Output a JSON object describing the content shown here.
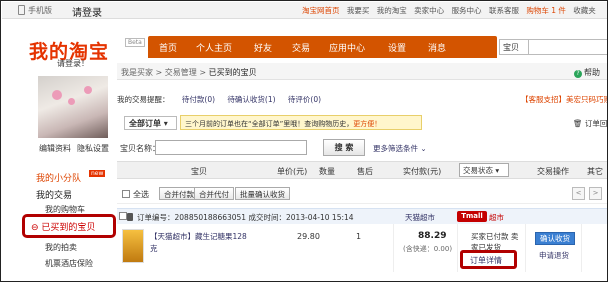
{
  "topbar": {
    "mobile": "手机版",
    "login": "请登录",
    "links": [
      "淘宝网首页",
      "我要买",
      "我的淘宝",
      "卖家中心",
      "服务中心",
      "联系客服",
      "购物车 1 件",
      "收藏夹"
    ]
  },
  "header": {
    "brand": "我的淘宝",
    "beta": "Beta",
    "please_login": "请登录！",
    "nav": [
      "首页",
      "个人主页",
      "好友",
      "交易",
      "应用中心",
      "设置",
      "消息"
    ],
    "search_select": "宝贝"
  },
  "sidebar": {
    "edit_profile": "编辑资料",
    "privacy": "隐私设置",
    "my_team": "我的小分队",
    "new_badge": "new",
    "my_trades": "我的交易",
    "items": [
      "我的购物车",
      "已买到的宝贝",
      "我的拍卖",
      "机票酒店保险"
    ]
  },
  "breadcrumb": {
    "items": [
      "我是买家",
      "交易管理",
      "已买到的宝贝"
    ],
    "separator": " > ",
    "help": "帮助"
  },
  "reminder": {
    "label": "我的交易提醒：",
    "links": [
      "待付款(0)",
      "待确认收货(1)",
      "待评价(0)"
    ],
    "support": "【客服支招】美宏只码巧购"
  },
  "filter": {
    "all_orders": "全部订单",
    "notice_prefix": "三个月前的订单也在“全部订单”里哦！查询购物历史，",
    "notice_link": "更方便！",
    "recycle": "订单回收站"
  },
  "search": {
    "label": "宝贝名称：",
    "button": "搜 索",
    "more": "更多筛选条件"
  },
  "table_header": {
    "item": "宝贝",
    "unit_price": "单价(元)",
    "quantity": "数量",
    "after_sales": "售后",
    "paid": "实付款(元)",
    "status": "交易状态",
    "operation": "交易操作",
    "other": "其它"
  },
  "batch": {
    "select_all": "全选",
    "merge_pay": "合并付款",
    "merge_agent": "合并代付",
    "batch_confirm": "批量确认收货",
    "prev": "<",
    "next": ">"
  },
  "order": {
    "header": "订单编号：208850188663051   成交时间：2013-04-10 15:14",
    "shop": "天猫超市",
    "tmall": "Tmall",
    "supermarket": "超市",
    "product": "【天猫超市】藏生记糖果128克",
    "unit_price": "29.80",
    "quantity": "1",
    "total": "88.29",
    "shipping": "(含快递：0.00)",
    "status": "买家已付款 卖家已发货",
    "detail": "订单详情",
    "confirm": "确认收货",
    "refund": "申请退货"
  }
}
